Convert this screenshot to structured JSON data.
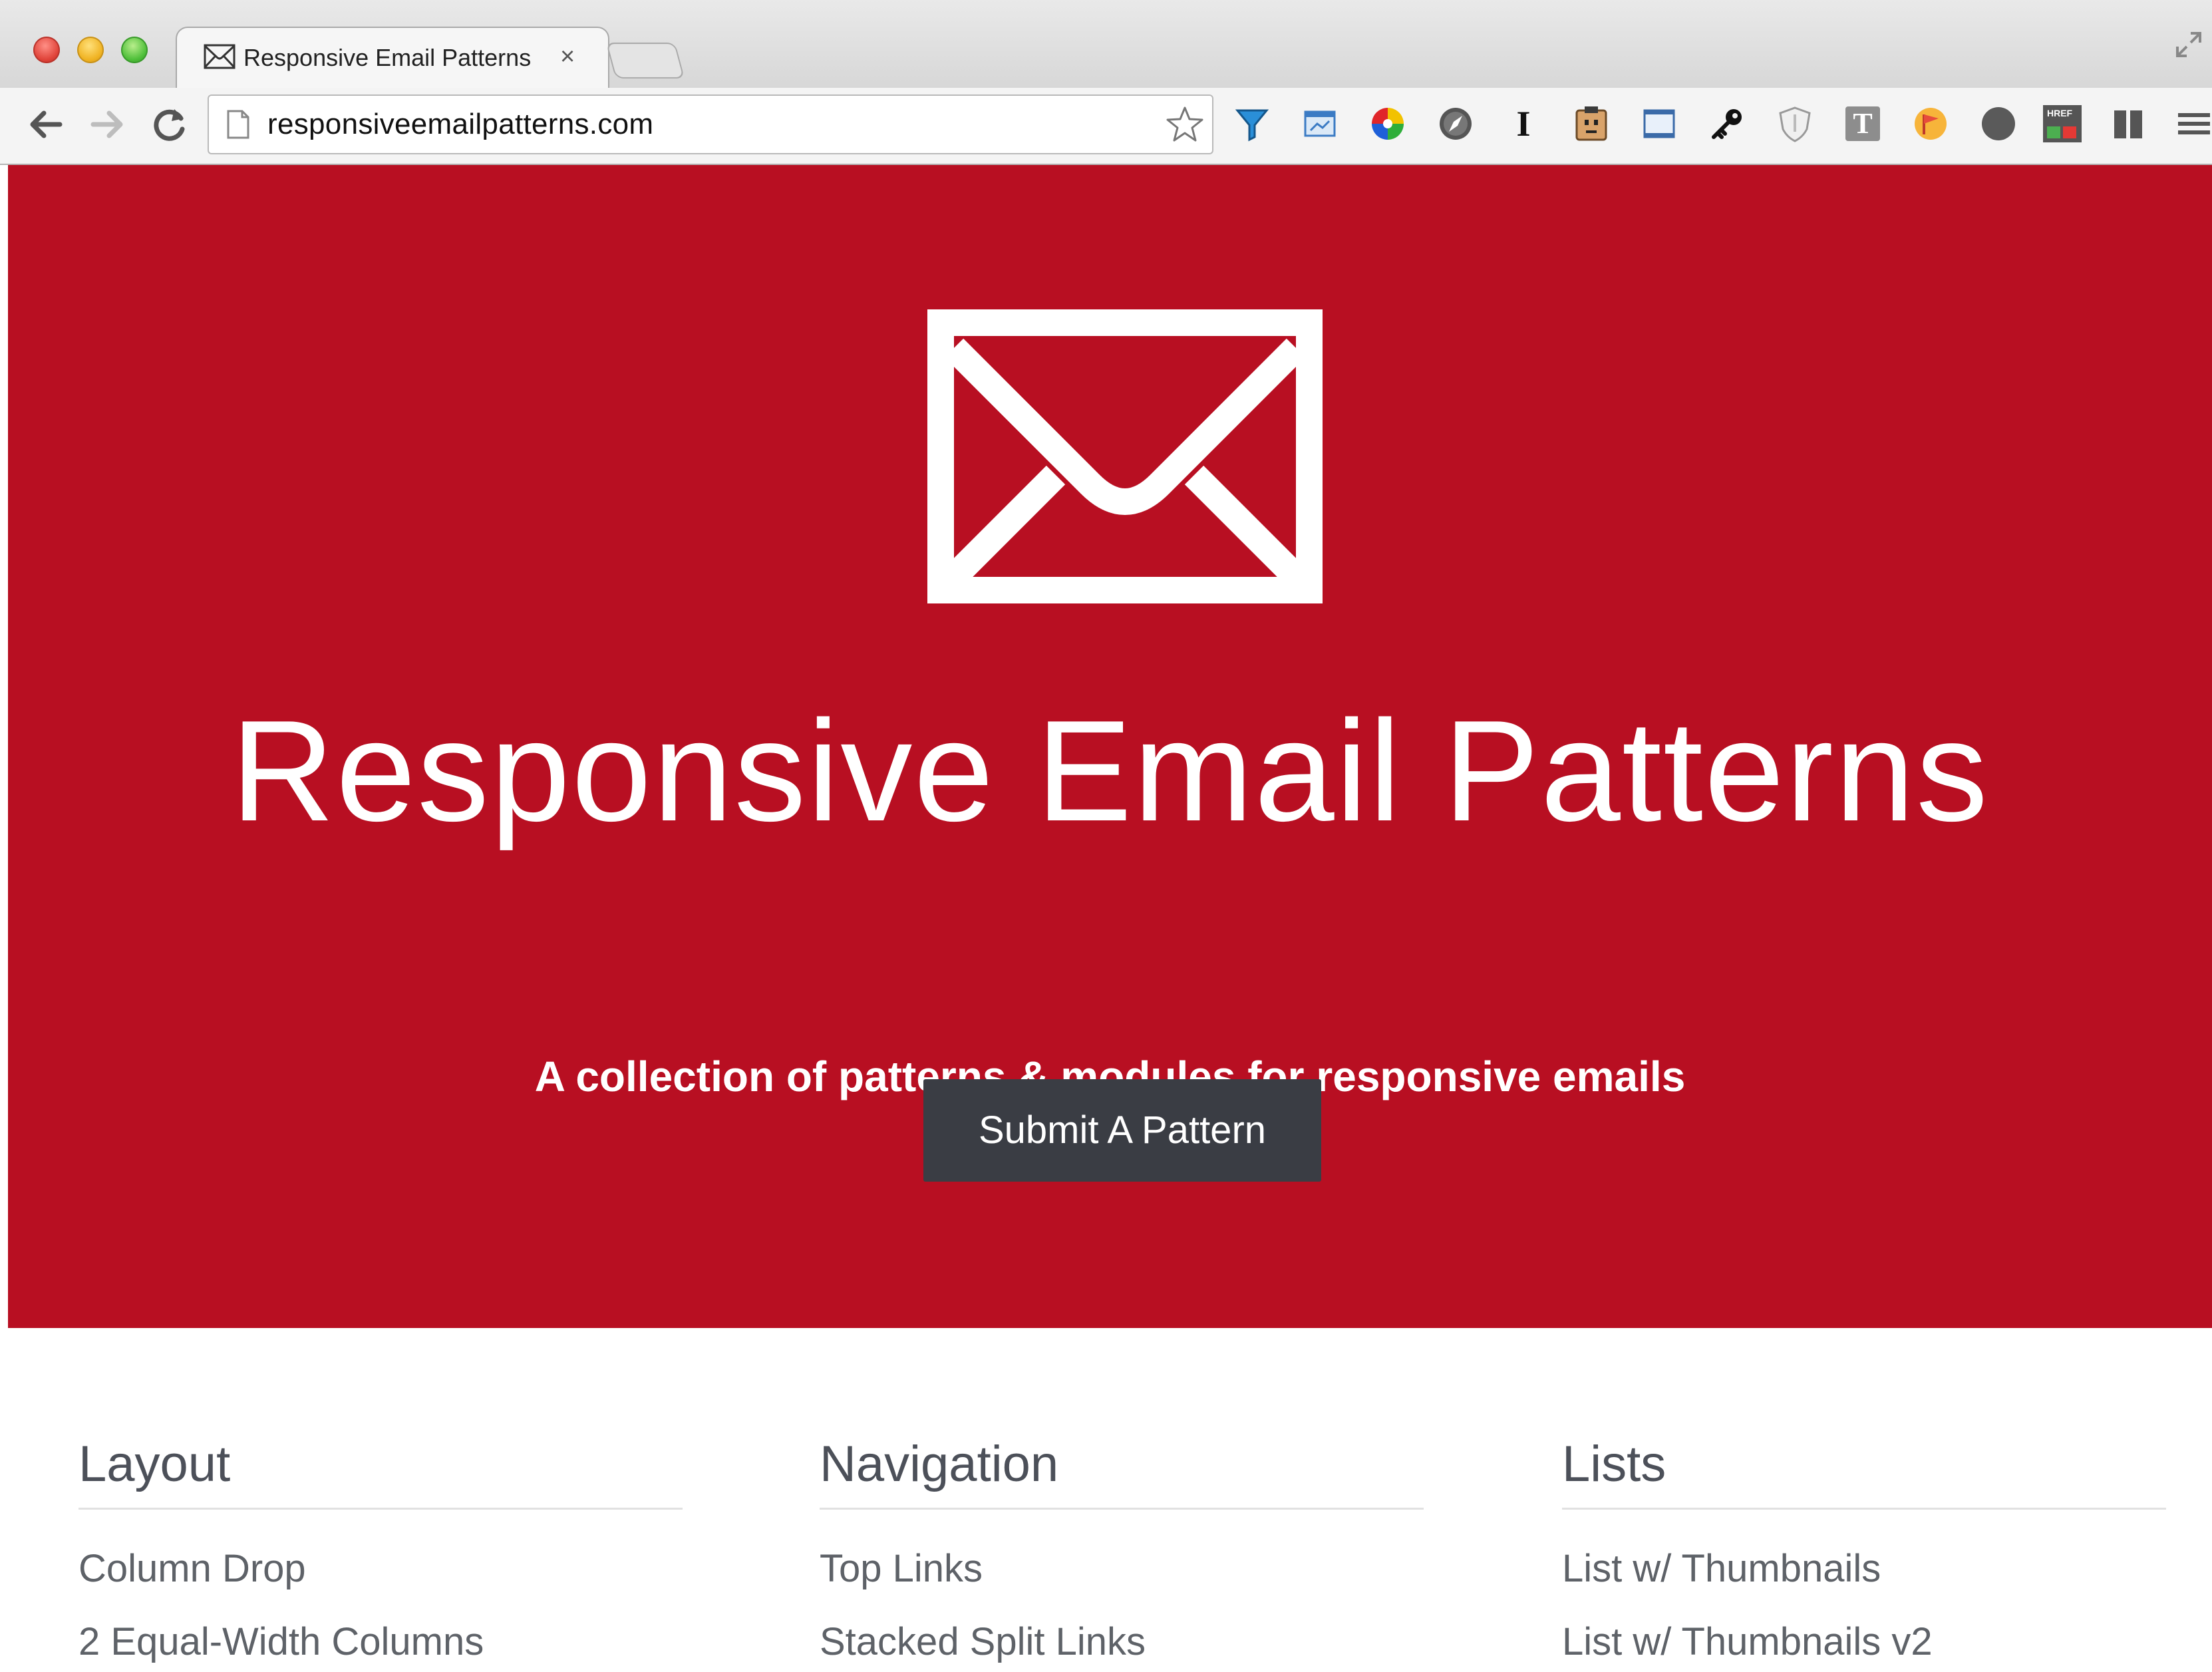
{
  "browser": {
    "tab_title": "Responsive Email Patterns",
    "tab_close": "×",
    "url": "responsiveemailpatterns.com",
    "extensions": [
      "funnel-extension-icon",
      "screenshot-extension-icon",
      "color-wheel-extension-icon",
      "compass-extension-icon",
      "text-cursor-extension-icon",
      "face-extension-icon",
      "window-resizer-extension-icon",
      "key-extension-icon",
      "shield-extension-icon",
      "t-extension-icon",
      "flag-extension-icon",
      "dark-circle-extension-icon",
      "href-extension-icon",
      "columns-extension-icon",
      "menu-icon"
    ],
    "extension_labels": {
      "text_cursor": "I",
      "t_badge": "T",
      "href_badge": "HREF"
    }
  },
  "hero": {
    "title": "Responsive Email Patterns",
    "tagline": "A collection of patterns & modules for responsive emails",
    "submit_label": "Submit A Pattern",
    "background_color": "#b80f22",
    "button_color": "#3a3d44"
  },
  "sections": [
    {
      "title": "Layout",
      "items": [
        "Column Drop",
        "2 Equal-Width Columns"
      ]
    },
    {
      "title": "Navigation",
      "items": [
        "Top Links",
        "Stacked Split Links"
      ]
    },
    {
      "title": "Lists",
      "items": [
        "List w/ Thumbnails",
        "List w/ Thumbnails v2"
      ]
    }
  ]
}
